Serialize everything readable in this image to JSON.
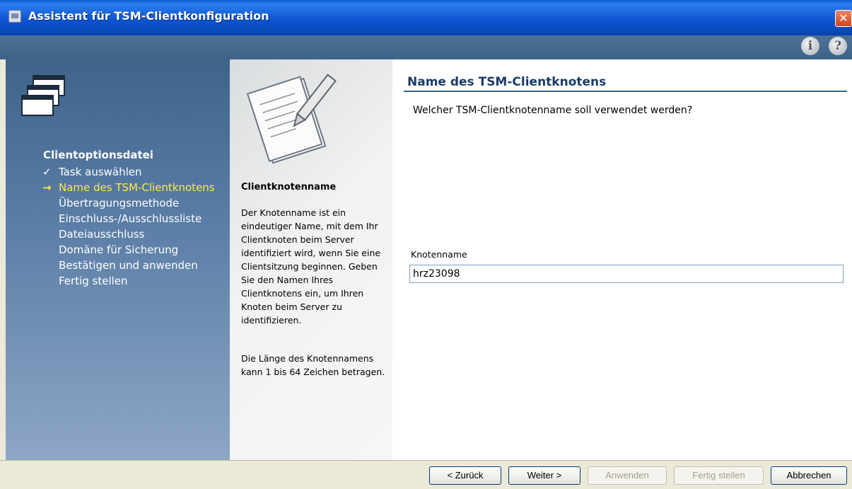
{
  "window": {
    "title": "Assistent für TSM-Clientkonfiguration",
    "close_glyph": "✕"
  },
  "header_icons": [
    {
      "icon": "info-icon",
      "glyph": "i"
    },
    {
      "icon": "help-icon",
      "glyph": "?"
    }
  ],
  "sidebar": {
    "heading": "Clientoptionsdatei",
    "items": [
      {
        "label": "Task auswählen",
        "mark": "✓",
        "state": "done"
      },
      {
        "label": "Name des TSM-Clientknotens",
        "mark": "→",
        "state": "current"
      },
      {
        "label": "Übertragungsmethode",
        "mark": "",
        "state": "pending"
      },
      {
        "label": "Einschluss-/Ausschlussliste",
        "mark": "",
        "state": "pending"
      },
      {
        "label": "Dateiausschluss",
        "mark": "",
        "state": "pending"
      },
      {
        "label": "Domäne für Sicherung",
        "mark": "",
        "state": "pending"
      },
      {
        "label": "Bestätigen und anwenden",
        "mark": "",
        "state": "pending"
      },
      {
        "label": "Fertig stellen",
        "mark": "",
        "state": "pending"
      }
    ]
  },
  "info": {
    "title": "Clientknotenname",
    "paragraph1": "Der Knotenname ist ein eindeutiger Name, mit dem Ihr Clientknoten beim Server identifiziert wird, wenn Sie eine Clientsitzung beginnen. Geben Sie den Namen Ihres Clientknotens ein, um Ihren Knoten beim Server zu identifizieren.",
    "paragraph2": "Die Länge des Knotennamens kann 1 bis 64 Zeichen betragen."
  },
  "main": {
    "title": "Name des TSM-Clientknotens",
    "question": "Welcher TSM-Clientknotenname soll verwendet werden?",
    "field_label": "Knotenname",
    "field_value": "hrz23098"
  },
  "buttons": {
    "back": "< Zurück",
    "next": "Weiter >",
    "apply": "Anwenden",
    "finish": "Fertig stellen",
    "cancel": "Abbrechen"
  },
  "colors": {
    "titlebar": "#0d55d0",
    "nav_current": "#ffe84a",
    "main_title": "#1a3b69"
  }
}
